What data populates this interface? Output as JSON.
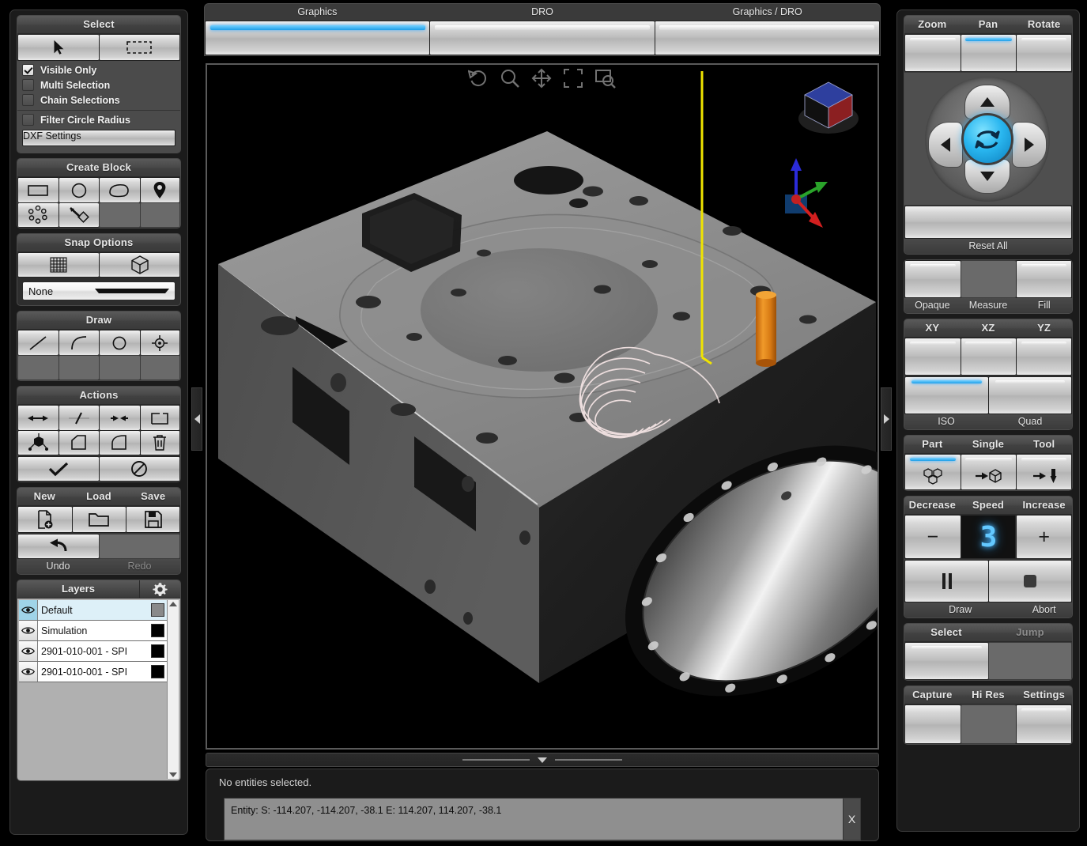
{
  "app": {
    "accent_blue": "#29b6ef",
    "panel_bg": "#1b1b1b",
    "group_bg": "#2e2e2e"
  },
  "left_panel": {
    "select": {
      "title": "Select",
      "buttons": [
        {
          "name": "pointer-select",
          "icon": "cursor-arrow-icon"
        },
        {
          "name": "box-select",
          "icon": "marquee-rectangle-icon"
        }
      ],
      "checkboxes": [
        {
          "label": "Visible Only",
          "checked": true
        },
        {
          "label": "Multi Selection",
          "checked": false
        },
        {
          "label": "Chain Selections",
          "checked": false
        },
        {
          "label": "Filter Circle Radius",
          "checked": false
        }
      ],
      "dxf_settings_label": "DXF Settings"
    },
    "create_block": {
      "title": "Create Block",
      "buttons": [
        {
          "name": "rectangle-block",
          "icon": "rectangle-icon",
          "enabled": true
        },
        {
          "name": "circle-block",
          "icon": "circle-icon",
          "enabled": true
        },
        {
          "name": "freeform-block",
          "icon": "teardrop-icon",
          "enabled": true
        },
        {
          "name": "point-block",
          "icon": "map-pin-icon",
          "enabled": true
        },
        {
          "name": "bolt-circle-block",
          "icon": "bolt-circle-icon",
          "enabled": true
        },
        {
          "name": "probe-block",
          "icon": "probe-point-icon",
          "enabled": true
        },
        {
          "name": "empty-slot-1",
          "icon": "",
          "enabled": false
        },
        {
          "name": "empty-slot-2",
          "icon": "",
          "enabled": false
        }
      ]
    },
    "snap_options": {
      "title": "Snap Options",
      "buttons": [
        {
          "name": "grid-snap",
          "icon": "grid-icon"
        },
        {
          "name": "object-snap",
          "icon": "cube-icon"
        }
      ],
      "combo_value": "None",
      "combo_options": [
        "None"
      ]
    },
    "draw": {
      "title": "Draw",
      "buttons": [
        {
          "name": "draw-line",
          "icon": "line-icon",
          "enabled": true
        },
        {
          "name": "draw-arc",
          "icon": "arc-icon",
          "enabled": true
        },
        {
          "name": "draw-circle",
          "icon": "circle-outline-icon",
          "enabled": true
        },
        {
          "name": "draw-point",
          "icon": "crosshair-point-icon",
          "enabled": true
        },
        {
          "name": "draw-empty-1",
          "icon": "",
          "enabled": false
        },
        {
          "name": "draw-empty-2",
          "icon": "",
          "enabled": false
        },
        {
          "name": "draw-empty-3",
          "icon": "",
          "enabled": false
        },
        {
          "name": "draw-empty-4",
          "icon": "",
          "enabled": false
        }
      ]
    },
    "actions": {
      "title": "Actions",
      "buttons": [
        {
          "name": "extend-both",
          "icon": "double-arrow-icon"
        },
        {
          "name": "split-entity",
          "icon": "split-line-icon"
        },
        {
          "name": "trim-entity",
          "icon": "trim-arrows-icon"
        },
        {
          "name": "offset-path",
          "icon": "offset-rect-icon"
        },
        {
          "name": "move-cube",
          "icon": "move-cube-icon"
        },
        {
          "name": "chamfer",
          "icon": "chamfer-icon"
        },
        {
          "name": "fillet",
          "icon": "fillet-icon"
        },
        {
          "name": "delete-entity",
          "icon": "trash-icon"
        }
      ],
      "confirm": {
        "name": "accept",
        "icon": "checkmark-icon"
      },
      "cancel": {
        "name": "cancel",
        "icon": "no-entry-icon"
      }
    },
    "file": {
      "labels": [
        "New",
        "Load",
        "Save"
      ],
      "buttons": [
        {
          "name": "new-file",
          "icon": "new-document-icon"
        },
        {
          "name": "load-file",
          "icon": "folder-icon"
        },
        {
          "name": "save-file",
          "icon": "floppy-disk-icon"
        }
      ],
      "undo_label": "Undo",
      "redo_label": "Redo",
      "undo_icon": "undo-arrow-icon",
      "redo_enabled": false
    },
    "layers": {
      "title": "Layers",
      "settings_icon": "gear-icon",
      "rows": [
        {
          "name": "Default",
          "color": "#8a8a8a",
          "visible": true,
          "selected": true
        },
        {
          "name": "Simulation",
          "color": "#000000",
          "visible": true,
          "selected": false
        },
        {
          "name": "2901-010-001 - SPI",
          "color": "#000000",
          "visible": true,
          "selected": false
        },
        {
          "name": "2901-010-001 - SPI",
          "color": "#000000",
          "visible": true,
          "selected": false
        }
      ]
    }
  },
  "center": {
    "tabs": [
      {
        "label": "Graphics",
        "active": true
      },
      {
        "label": "DRO",
        "active": false
      },
      {
        "label": "Graphics / DRO",
        "active": false
      }
    ],
    "viewport_toolbar": [
      {
        "name": "reset-view-icon",
        "title": "reset"
      },
      {
        "name": "zoom-glass-icon",
        "title": "zoom"
      },
      {
        "name": "pan-move-icon",
        "title": "pan"
      },
      {
        "name": "fit-to-window-icon",
        "title": "fit"
      },
      {
        "name": "zoom-window-icon",
        "title": "zoom window"
      }
    ],
    "viewcube": {
      "name": "view-orientation-cube",
      "top_color": "#2e3f9e",
      "right_color": "#8b1f21",
      "front_color": "#111111"
    },
    "axis_triad": {
      "x_color": "#d21f1f",
      "y_color": "#2aa32a",
      "z_color": "#2b2bd8"
    },
    "status": {
      "selection_text": "No entities selected.",
      "entity_text": "Entity: S: -114.207, -114.207, -38.1 E: 114.207, 114.207, -38.1",
      "close_label": "X"
    }
  },
  "right_panel": {
    "view_nav": {
      "modes": [
        {
          "label": "Zoom",
          "active": false
        },
        {
          "label": "Pan",
          "active": true
        },
        {
          "label": "Rotate",
          "active": false
        }
      ],
      "pad": {
        "up": "pad-up-arrow",
        "down": "pad-down-arrow",
        "left": "pad-left-arrow",
        "right": "pad-right-arrow",
        "center": "pad-reset-rotate"
      },
      "reset_label": "Reset All"
    },
    "display": {
      "buttons": [
        {
          "label": "Opaque",
          "active": false,
          "enabled": true
        },
        {
          "label": "Measure",
          "active": false,
          "enabled": false
        },
        {
          "label": "Fill",
          "active": false,
          "enabled": true
        }
      ]
    },
    "views": {
      "top_row": [
        {
          "label": "XY",
          "active": false
        },
        {
          "label": "XZ",
          "active": false
        },
        {
          "label": "YZ",
          "active": false
        }
      ],
      "bottom_row": [
        {
          "label": "ISO",
          "active": true
        },
        {
          "label": "Quad",
          "active": false
        }
      ]
    },
    "sim_mode": {
      "buttons": [
        {
          "label": "Part",
          "active": true,
          "icon": "part-blocks-icon"
        },
        {
          "label": "Single",
          "active": false,
          "icon": "arrow-to-cube-icon"
        },
        {
          "label": "Tool",
          "active": false,
          "icon": "arrow-to-tool-icon"
        }
      ]
    },
    "speed": {
      "decrease_label": "Decrease",
      "title": "Speed",
      "increase_label": "Increase",
      "minus": "−",
      "plus": "+",
      "value": "3"
    },
    "run": {
      "draw_label": "Draw",
      "abort_label": "Abort",
      "draw_icon": "pause-icon",
      "abort_icon": "stop-square-icon"
    },
    "select_jump": {
      "select_label": "Select",
      "jump_label": "Jump",
      "jump_enabled": false
    },
    "capture": {
      "buttons": [
        {
          "label": "Capture",
          "active": false,
          "enabled": true
        },
        {
          "label": "Hi Res",
          "active": false,
          "enabled": false
        },
        {
          "label": "Settings",
          "active": false,
          "enabled": true
        }
      ]
    }
  }
}
